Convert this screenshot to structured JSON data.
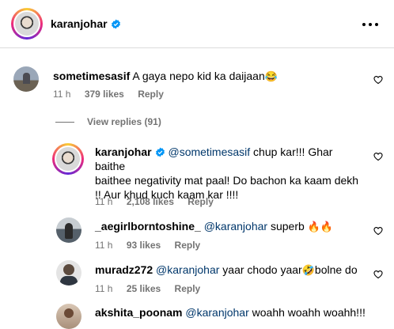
{
  "post": {
    "author": "karanjohar",
    "verified_icon": "verified-badge-icon",
    "more_icon": "more-options-icon"
  },
  "comments": [
    {
      "username": "sometimesasif",
      "text": "A gaya nepo kid ka daijaan",
      "emoji": "😂",
      "time": "11 h",
      "likes": "379 likes",
      "reply": "Reply"
    }
  ],
  "view_replies": "View replies (91)",
  "replies": [
    {
      "username": "karanjohar",
      "mention": "@sometimesasif",
      "text_line1": " chup kar!!! Ghar baithe",
      "text_line2": "baithee negativity mat paal! Do bachon ka kaam dekh",
      "text_line3": "!! Aur khud kuch kaam kar !!!!",
      "time": "11 h",
      "likes": "2,108 likes",
      "reply": "Reply"
    },
    {
      "username": "_aegirlborntoshine_",
      "mention": "@karanjohar",
      "text": " superb ",
      "emoji": "🔥🔥",
      "time": "11 h",
      "likes": "93 likes",
      "reply": "Reply"
    },
    {
      "username": "muradz272",
      "mention": "@karanjohar",
      "text": " yaar chodo yaar",
      "emoji": "🤣",
      "text_after": "bolne do",
      "time": "11 h",
      "likes": "25 likes",
      "reply": "Reply"
    },
    {
      "username": "akshita_poonam",
      "mention": "@karanjohar",
      "text": " woahh woahh woahh!!!"
    }
  ],
  "colors": {
    "mention": "#00376b",
    "meta": "#737373",
    "verified": "#0095f6"
  }
}
